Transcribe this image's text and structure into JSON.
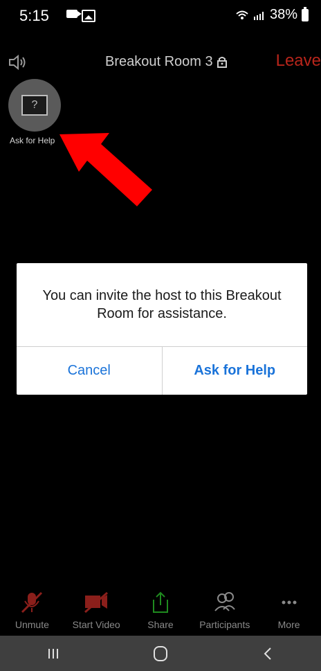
{
  "status_bar": {
    "time": "5:15",
    "battery_percent": "38%"
  },
  "header": {
    "room_title": "Breakout Room 3",
    "leave_label": "Leave"
  },
  "ask_help_fab": {
    "caption": "Ask for Help",
    "box_text": "?"
  },
  "dialog": {
    "message": "You can invite the host to this Breakout Room for assistance.",
    "cancel_label": "Cancel",
    "primary_label": "Ask for Help"
  },
  "toolbar": {
    "items": [
      {
        "label": "Unmute",
        "icon": "mic-muted-icon"
      },
      {
        "label": "Start Video",
        "icon": "video-off-icon"
      },
      {
        "label": "Share",
        "icon": "share-icon"
      },
      {
        "label": "Participants",
        "icon": "participants-icon"
      },
      {
        "label": "More",
        "icon": "more-icon"
      }
    ]
  },
  "colors": {
    "background": "#000000",
    "leave": "#b8251b",
    "dialog_button": "#1a73d9",
    "arrow": "#ff0000",
    "toolbar_red": "#8b1f1b",
    "share_green": "#1f8b1f"
  },
  "nav": {
    "recents_icon": "recents-icon",
    "home_icon": "home-icon",
    "back_icon": "back-icon"
  }
}
